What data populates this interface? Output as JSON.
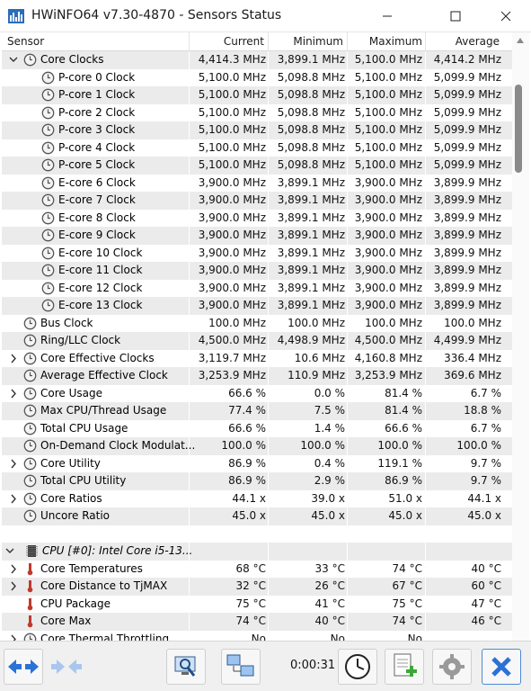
{
  "window": {
    "title": "HWiNFO64 v7.30-4870 - Sensors Status"
  },
  "columns": {
    "sensor": "Sensor",
    "current": "Current",
    "minimum": "Minimum",
    "maximum": "Maximum",
    "average": "Average"
  },
  "rows": [
    {
      "label": "Core Clocks",
      "cur": "4,414.3 MHz",
      "min": "3,899.1 MHz",
      "max": "5,100.0 MHz",
      "avg": "4,414.2 MHz"
    },
    {
      "label": "P-core 0 Clock",
      "cur": "5,100.0 MHz",
      "min": "5,098.8 MHz",
      "max": "5,100.0 MHz",
      "avg": "5,099.9 MHz"
    },
    {
      "label": "P-core 1 Clock",
      "cur": "5,100.0 MHz",
      "min": "5,098.8 MHz",
      "max": "5,100.0 MHz",
      "avg": "5,099.9 MHz"
    },
    {
      "label": "P-core 2 Clock",
      "cur": "5,100.0 MHz",
      "min": "5,098.8 MHz",
      "max": "5,100.0 MHz",
      "avg": "5,099.9 MHz"
    },
    {
      "label": "P-core 3 Clock",
      "cur": "5,100.0 MHz",
      "min": "5,098.8 MHz",
      "max": "5,100.0 MHz",
      "avg": "5,099.9 MHz"
    },
    {
      "label": "P-core 4 Clock",
      "cur": "5,100.0 MHz",
      "min": "5,098.8 MHz",
      "max": "5,100.0 MHz",
      "avg": "5,099.9 MHz"
    },
    {
      "label": "P-core 5 Clock",
      "cur": "5,100.0 MHz",
      "min": "5,098.8 MHz",
      "max": "5,100.0 MHz",
      "avg": "5,099.9 MHz"
    },
    {
      "label": "E-core 6 Clock",
      "cur": "3,900.0 MHz",
      "min": "3,899.1 MHz",
      "max": "3,900.0 MHz",
      "avg": "3,899.9 MHz"
    },
    {
      "label": "E-core 7 Clock",
      "cur": "3,900.0 MHz",
      "min": "3,899.1 MHz",
      "max": "3,900.0 MHz",
      "avg": "3,899.9 MHz"
    },
    {
      "label": "E-core 8 Clock",
      "cur": "3,900.0 MHz",
      "min": "3,899.1 MHz",
      "max": "3,900.0 MHz",
      "avg": "3,899.9 MHz"
    },
    {
      "label": "E-core 9 Clock",
      "cur": "3,900.0 MHz",
      "min": "3,899.1 MHz",
      "max": "3,900.0 MHz",
      "avg": "3,899.9 MHz"
    },
    {
      "label": "E-core 10 Clock",
      "cur": "3,900.0 MHz",
      "min": "3,899.1 MHz",
      "max": "3,900.0 MHz",
      "avg": "3,899.9 MHz"
    },
    {
      "label": "E-core 11 Clock",
      "cur": "3,900.0 MHz",
      "min": "3,899.1 MHz",
      "max": "3,900.0 MHz",
      "avg": "3,899.9 MHz"
    },
    {
      "label": "E-core 12 Clock",
      "cur": "3,900.0 MHz",
      "min": "3,899.1 MHz",
      "max": "3,900.0 MHz",
      "avg": "3,899.9 MHz"
    },
    {
      "label": "E-core 13 Clock",
      "cur": "3,900.0 MHz",
      "min": "3,899.1 MHz",
      "max": "3,900.0 MHz",
      "avg": "3,899.9 MHz"
    },
    {
      "label": "Bus Clock",
      "cur": "100.0 MHz",
      "min": "100.0 MHz",
      "max": "100.0 MHz",
      "avg": "100.0 MHz"
    },
    {
      "label": "Ring/LLC Clock",
      "cur": "4,500.0 MHz",
      "min": "4,498.9 MHz",
      "max": "4,500.0 MHz",
      "avg": "4,499.9 MHz"
    },
    {
      "label": "Core Effective Clocks",
      "cur": "3,119.7 MHz",
      "min": "10.6 MHz",
      "max": "4,160.8 MHz",
      "avg": "336.4 MHz"
    },
    {
      "label": "Average Effective Clock",
      "cur": "3,253.9 MHz",
      "min": "110.9 MHz",
      "max": "3,253.9 MHz",
      "avg": "369.6 MHz"
    },
    {
      "label": "Core Usage",
      "cur": "66.6 %",
      "min": "0.0 %",
      "max": "81.4 %",
      "avg": "6.7 %"
    },
    {
      "label": "Max CPU/Thread Usage",
      "cur": "77.4 %",
      "min": "7.5 %",
      "max": "81.4 %",
      "avg": "18.8 %"
    },
    {
      "label": "Total CPU Usage",
      "cur": "66.6 %",
      "min": "1.4 %",
      "max": "66.6 %",
      "avg": "6.7 %"
    },
    {
      "label": "On-Demand Clock Modulat...",
      "cur": "100.0 %",
      "min": "100.0 %",
      "max": "100.0 %",
      "avg": "100.0 %"
    },
    {
      "label": "Core Utility",
      "cur": "86.9 %",
      "min": "0.4 %",
      "max": "119.1 %",
      "avg": "9.7 %"
    },
    {
      "label": "Total CPU Utility",
      "cur": "86.9 %",
      "min": "2.9 %",
      "max": "86.9 %",
      "avg": "9.7 %"
    },
    {
      "label": "Core Ratios",
      "cur": "44.1 x",
      "min": "39.0 x",
      "max": "51.0 x",
      "avg": "44.1 x"
    },
    {
      "label": "Uncore Ratio",
      "cur": "45.0 x",
      "min": "45.0 x",
      "max": "45.0 x",
      "avg": "45.0 x"
    },
    {
      "label": "",
      "cur": "",
      "min": "",
      "max": "",
      "avg": ""
    },
    {
      "label": "CPU [#0]: Intel Core i5-13...",
      "cur": "",
      "min": "",
      "max": "",
      "avg": ""
    },
    {
      "label": "Core Temperatures",
      "cur": "68 °C",
      "min": "33 °C",
      "max": "74 °C",
      "avg": "40 °C"
    },
    {
      "label": "Core Distance to TjMAX",
      "cur": "32 °C",
      "min": "26 °C",
      "max": "67 °C",
      "avg": "60 °C"
    },
    {
      "label": "CPU Package",
      "cur": "75 °C",
      "min": "41 °C",
      "max": "75 °C",
      "avg": "47 °C"
    },
    {
      "label": "Core Max",
      "cur": "74 °C",
      "min": "40 °C",
      "max": "74 °C",
      "avg": "46 °C"
    },
    {
      "label": "Core Thermal Throttling",
      "cur": "No",
      "min": "No",
      "max": "No",
      "avg": ""
    }
  ],
  "toolbar": {
    "timer": "0:00:31"
  },
  "colors": {
    "shade": "#ebebeb",
    "accent": "#1f6fd1",
    "thermo": "#c0392b"
  },
  "icons": [
    "clock-icon",
    "thermometer-icon",
    "cpu-chip-icon",
    "expand-chevron-icon",
    "collapse-chevron-icon"
  ]
}
